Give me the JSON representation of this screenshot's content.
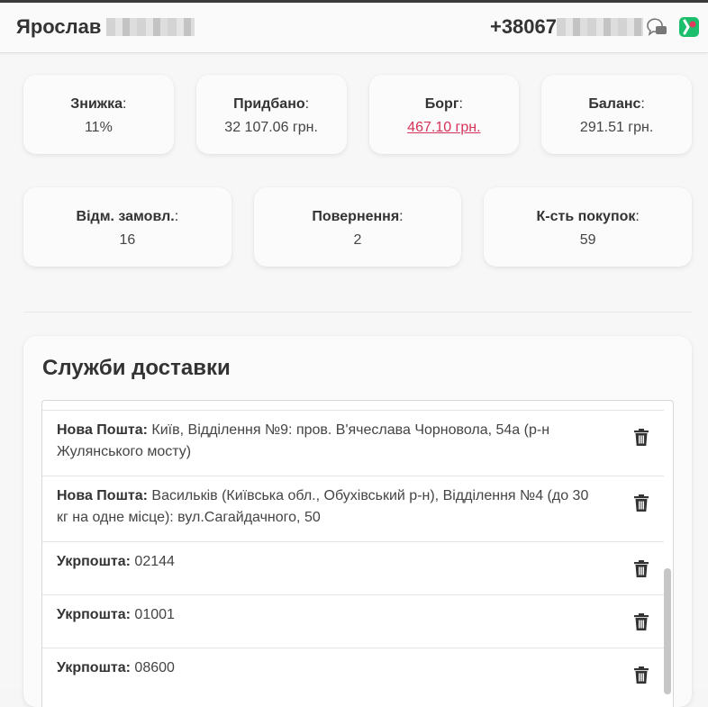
{
  "header": {
    "name": "Ярослав",
    "phone": "+38067"
  },
  "stats_row1": [
    {
      "label": "Знижка",
      "value": "11%"
    },
    {
      "label": "Придбано",
      "value": "32 107.06 грн."
    },
    {
      "label": "Борг",
      "value": "467.10 грн."
    },
    {
      "label": "Баланс",
      "value": "291.51 грн."
    }
  ],
  "stats_row2": [
    {
      "label": "Відм. замовл.",
      "value": "16"
    },
    {
      "label": "Повернення",
      "value": "2"
    },
    {
      "label": "К-сть покупок",
      "value": "59"
    }
  ],
  "delivery": {
    "title": "Служби доставки",
    "items": [
      {
        "carrier": "Нова Пошта:",
        "address": "Київ, Відділення №9: пров. В'ячеслава Чорновола, 54а (р-н Жулянського мосту)"
      },
      {
        "carrier": "Нова Пошта:",
        "address": "Васильків (Київська обл., Обухівський р-н), Відділення №4 (до 30 кг на одне місце): вул.Сагайдачного, 50"
      },
      {
        "carrier": "Укрпошта:",
        "address": "02144"
      },
      {
        "carrier": "Укрпошта:",
        "address": "01001"
      },
      {
        "carrier": "Укрпошта:",
        "address": "08600"
      }
    ]
  },
  "colors": {
    "debt": "#d6335a",
    "app_icon": "#1bbf6b"
  }
}
